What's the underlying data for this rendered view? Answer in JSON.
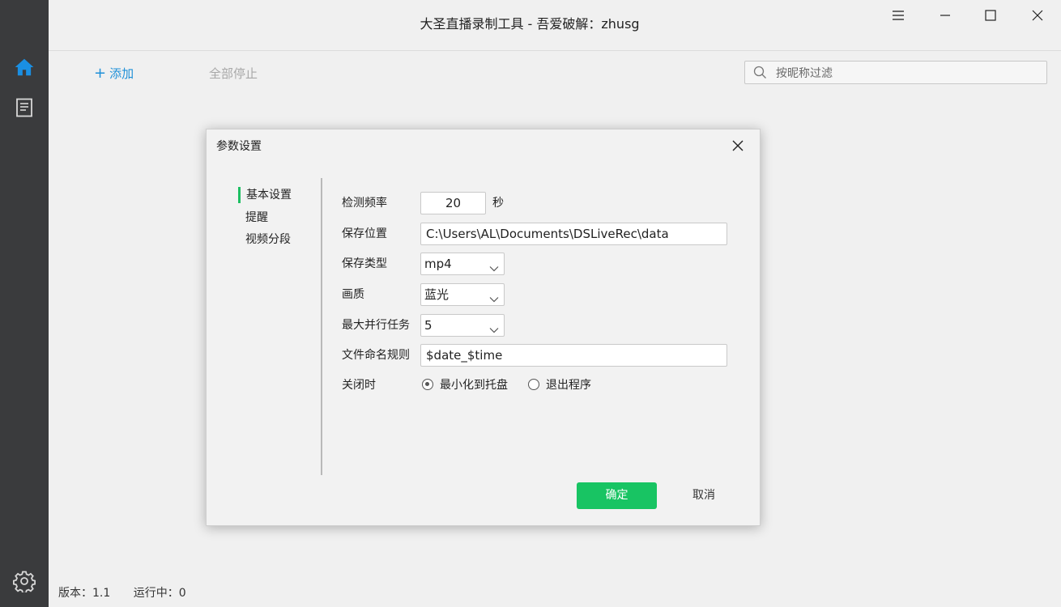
{
  "window": {
    "title": "大圣直播录制工具 - 吾爱破解：zhusg"
  },
  "sidebar": {
    "items": [
      {
        "name": "home",
        "icon": "home-icon"
      },
      {
        "name": "logs",
        "icon": "document-icon"
      },
      {
        "name": "settings",
        "icon": "gear-icon"
      }
    ]
  },
  "toolbar": {
    "add_label": "添加",
    "stop_all_label": "全部停止",
    "search_placeholder": "按昵称过滤"
  },
  "status": {
    "version": "版本：1.1",
    "running": "运行中：0"
  },
  "dialog": {
    "title": "参数设置",
    "nav": [
      "基本设置",
      "提醒",
      "视频分段"
    ],
    "fields": {
      "interval_label": "检测频率",
      "interval_value": "20",
      "interval_unit": "秒",
      "save_path_label": "保存位置",
      "save_path_value": "C:\\Users\\AL\\Documents\\DSLiveRec\\data",
      "save_type_label": "保存类型",
      "save_type_value": "mp4",
      "quality_label": "画质",
      "quality_value": "蓝光",
      "max_tasks_label": "最大并行任务",
      "max_tasks_value": "5",
      "naming_label": "文件命名规则",
      "naming_value": "$date_$time",
      "on_close_label": "关闭时",
      "on_close_options": [
        "最小化到托盘",
        "退出程序"
      ],
      "on_close_selected": 0
    },
    "ok_label": "确定",
    "cancel_label": "取消"
  },
  "colors": {
    "accent_green": "#18c463",
    "home_blue": "#1a8fe3",
    "link_blue": "#1e90d8",
    "sidebar_bg": "#3a3b3d"
  }
}
